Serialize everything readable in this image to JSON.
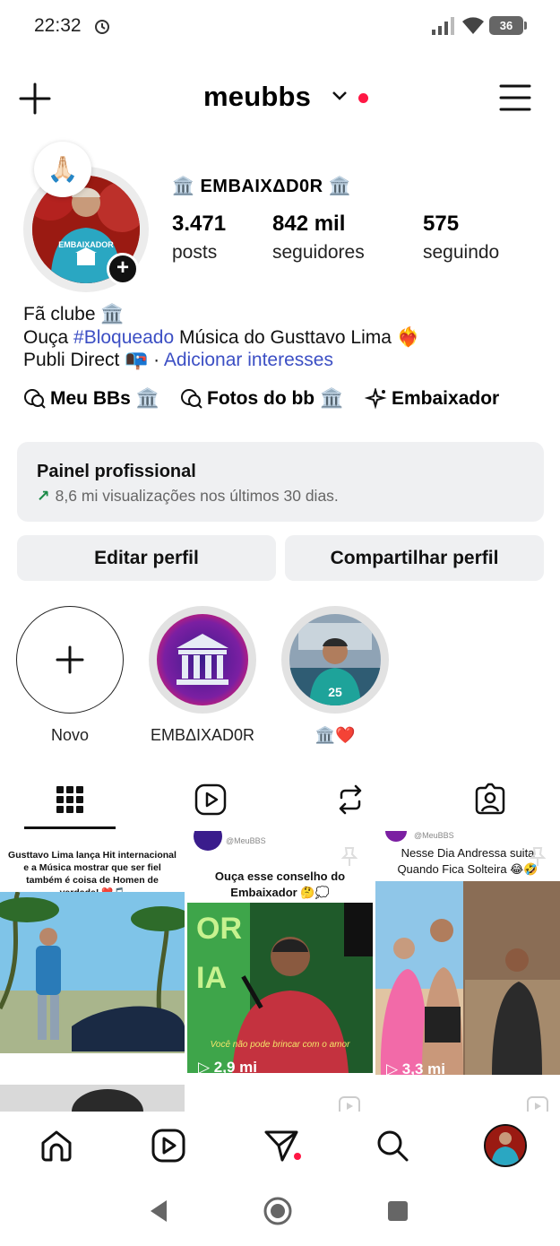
{
  "status_bar": {
    "time": "22:32",
    "battery": "36"
  },
  "top_nav": {
    "username": "meubbs"
  },
  "profile": {
    "note_emoji": "🙏🏻",
    "display_name": "🏛️ EMBAIXΔD0R 🏛️",
    "stats": [
      {
        "value": "3.471",
        "label": "posts"
      },
      {
        "value": "842 mil",
        "label": "seguidores"
      },
      {
        "value": "575",
        "label": "seguindo"
      }
    ],
    "bio": {
      "line1": "Fã clube 🏛️",
      "line2_prefix": "Ouça ",
      "line2_tag": "#Bloqueado",
      "line2_suffix": " Música do Gusttavo Lima ❤️‍🔥",
      "line3_prefix": "Publi Direct 📭 · ",
      "line3_link": "Adicionar interesses"
    },
    "links": [
      {
        "label": "Meu BBs 🏛️"
      },
      {
        "label": "Fotos do bb 🏛️"
      },
      {
        "label": "Embaixador"
      }
    ]
  },
  "professional_panel": {
    "title": "Painel profissional",
    "subtitle": "8,6 mi visualizações nos últimos 30 dias."
  },
  "actions": {
    "edit": "Editar perfil",
    "share": "Compartilhar perfil"
  },
  "highlights": [
    {
      "label": "Novo"
    },
    {
      "label": "EMBΔIXAD0R"
    },
    {
      "label": "🏛️❤️"
    }
  ],
  "tabs": [
    {
      "icon": "grid-icon"
    },
    {
      "icon": "reels-icon"
    },
    {
      "icon": "reposts-icon"
    },
    {
      "icon": "tagged-icon"
    }
  ],
  "grid_posts": [
    {
      "caption": "Gusttavo Lima lança Hit internacional e a Música mostrar que ser fiel também é coisa de Homen de verdade! ❤️🎵"
    },
    {
      "handle": "@MeuBBS",
      "caption": "Ouça esse conselho do Embaixador 🤔💭",
      "subtitle": "Você não pode brincar com o amor",
      "views": "2,9 mi"
    },
    {
      "handle": "@MeuBBS",
      "caption": "Nesse Dia Andressa suita Quando Fica Solteira 😂🤣",
      "views": "3,3 mi"
    }
  ],
  "colors": {
    "accent_blue": "#3c4fc4",
    "badge_red": "#ff1744",
    "panel_bg": "#eff0f2",
    "trend_green": "#1b8a47"
  }
}
